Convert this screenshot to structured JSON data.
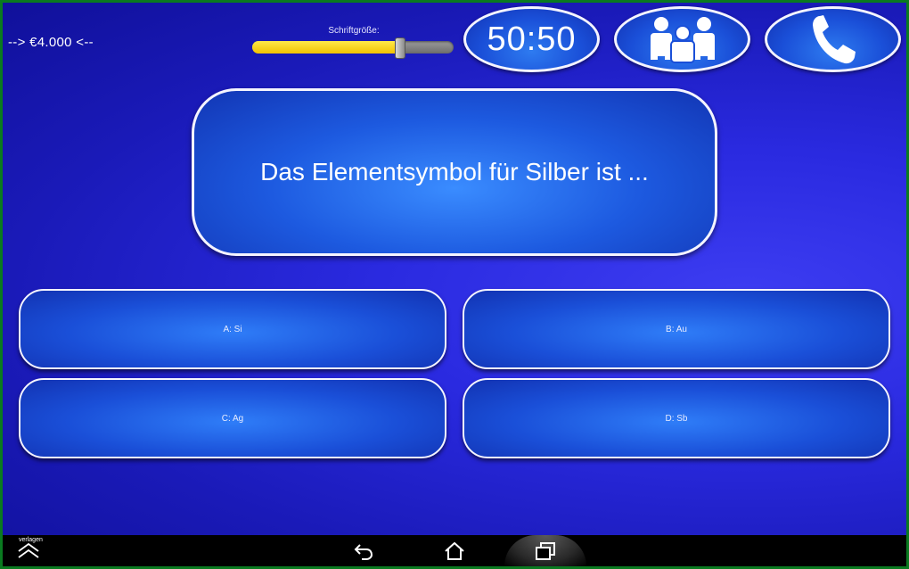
{
  "header": {
    "prize_label": "--> €4.000 <--",
    "font_size_label": "Schriftgröße:",
    "font_size_level": 0.73
  },
  "jokers": {
    "fifty_fifty_label": "50:50",
    "audience_icon": "audience-people-icon",
    "phone_icon": "phone-icon"
  },
  "question": {
    "text": "Das Elementsymbol für Silber ist ..."
  },
  "answers": [
    {
      "label": "A: Si"
    },
    {
      "label": "B: Au"
    },
    {
      "label": "C: Ag"
    },
    {
      "label": "D: Sb"
    }
  ],
  "navbar": {
    "corner_text": "verlagen",
    "icons": [
      "home-up-icon",
      "back-icon",
      "home-icon",
      "recent-apps-icon"
    ]
  },
  "colors": {
    "background": "#2a2ae0",
    "slider_fill": "#f2c200",
    "border": "#f4f4ff"
  }
}
